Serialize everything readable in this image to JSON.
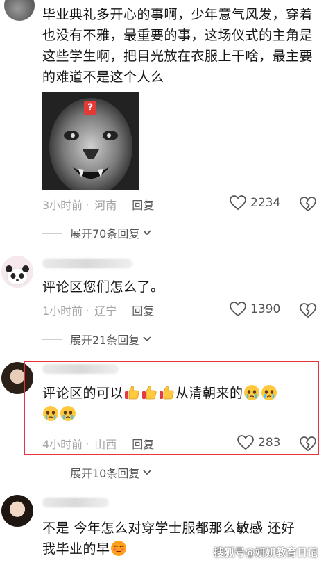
{
  "comments": [
    {
      "text": "毕业典礼多开心的事啊，少年意气风发，穿着也没有不雅，最重要的事，这场仪式的主角是这些学生啊，把目光放在衣服上干啥，最主要的难道不是这个人么",
      "image_badge": "?",
      "time": "3小时前",
      "region": "河南",
      "reply_label": "回复",
      "likes": "2234",
      "expand_label": "展开70条回复"
    },
    {
      "text": "评论区您们怎么了。",
      "time": "1小时前",
      "region": "辽宁",
      "reply_label": "回复",
      "likes": "1390",
      "expand_label": "展开21条回复"
    },
    {
      "text_before": "评论区的可以",
      "text_after": "从清朝来的",
      "time": "4小时前",
      "region": "山西",
      "reply_label": "回复",
      "likes": "283",
      "expand_label": "展开10条回复"
    },
    {
      "text_line1": "不是 今年怎么对穿学士服都那么敏感 还好",
      "text_line2": "我毕业的早"
    }
  ],
  "watermark": "搜狐号@妍妍教育日记",
  "colors": {
    "highlight_border": "#e8333f",
    "meta_text": "#a5a5a5",
    "reply_text": "#5a5a5a"
  },
  "icons": [
    "heart-icon",
    "broken-heart-icon",
    "chevron-down-icon",
    "thumbs-up-emoji",
    "crying-emoji",
    "blushing-emoji"
  ]
}
